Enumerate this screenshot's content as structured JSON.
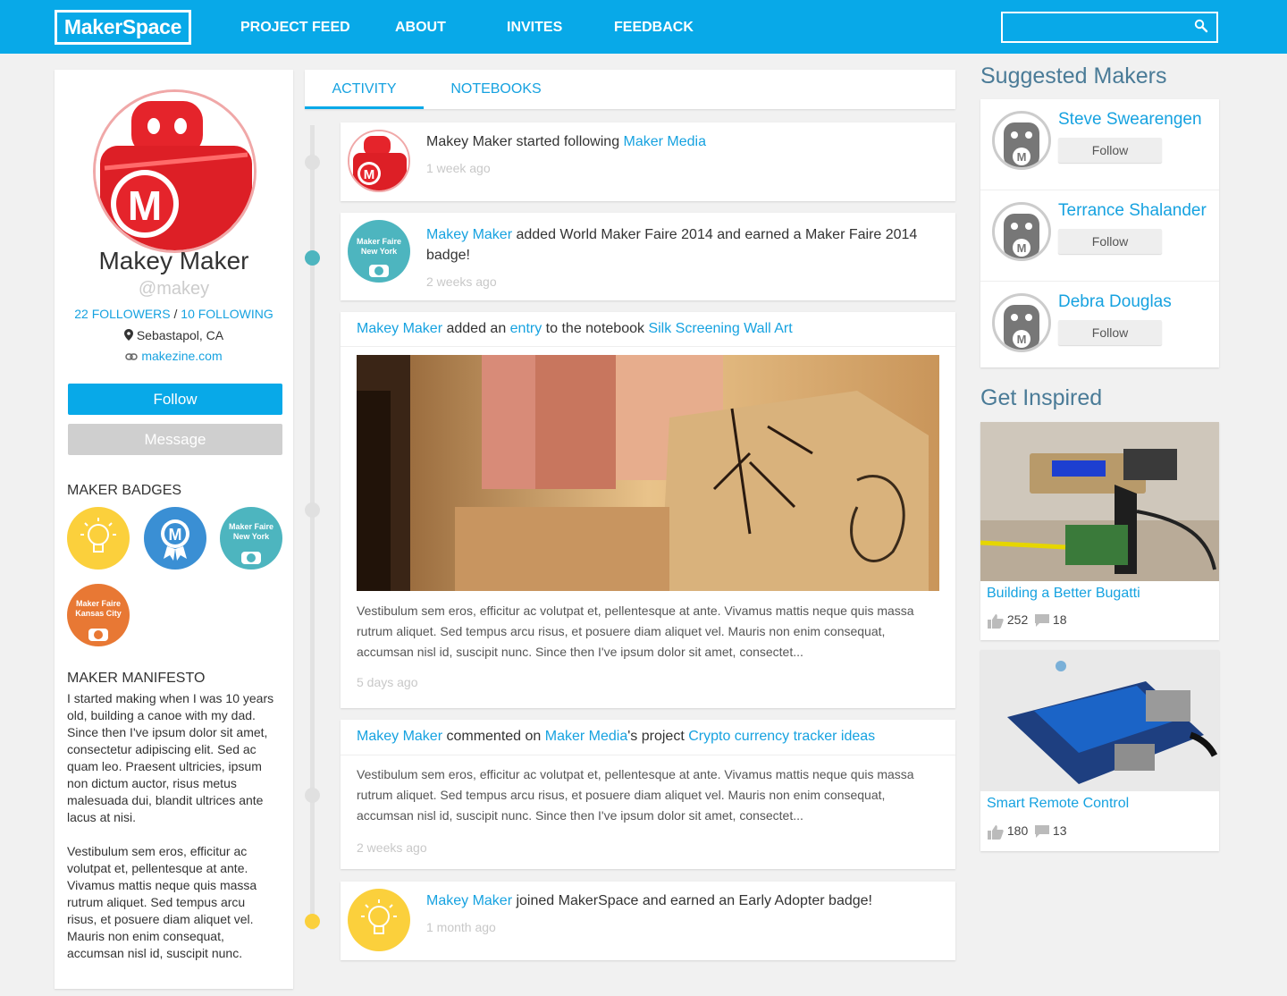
{
  "app": {
    "logo": "MakerSpace",
    "brand_color": "#08a9e8"
  },
  "nav": {
    "items": [
      "PROJECT FEED",
      "ABOUT",
      "INVITES",
      "FEEDBACK"
    ],
    "search_placeholder": ""
  },
  "profile": {
    "name": "Makey Maker",
    "handle": "@makey",
    "followers": "22 FOLLOWERS",
    "separator": "/",
    "following": "10 FOLLOWING",
    "location": "Sebastapol, CA",
    "website": "makezine.com",
    "follow_label": "Follow",
    "message_label": "Message",
    "badges_title": "MAKER BADGES",
    "badges": [
      {
        "icon": "lightbulb-icon",
        "color": "#fbd03c",
        "text": ""
      },
      {
        "icon": "maker-rosette-icon",
        "color": "#3a8fd4",
        "text": ""
      },
      {
        "icon": "maker-robot-icon",
        "color": "#4db5bf",
        "text": "Maker Faire New York"
      },
      {
        "icon": "maker-robot-icon",
        "color": "#e87834",
        "text": "Maker Faire Kansas City"
      }
    ],
    "manifesto_title": "MAKER MANIFESTO",
    "manifesto": [
      "I started making when I was 10 years old, building a canoe with my dad. Since then I've ipsum dolor sit amet, consectetur adipiscing elit. Sed ac quam leo. Praesent ultricies, ipsum non dictum auctor, risus metus malesuada dui, blandit ultrices ante lacus at nisi.",
      "Vestibulum sem eros, efficitur ac volutpat et, pellentesque at ante. Vivamus mattis neque quis massa rutrum aliquet. Sed tempus arcu risus, et posuere diam aliquet vel. Mauris non enim consequat, accumsan nisl id, suscipit nunc."
    ]
  },
  "tabs": {
    "activity": "ACTIVITY",
    "notebooks": "NOTEBOOKS"
  },
  "feed": {
    "item1": {
      "text": "Makey Maker started following ",
      "link": "Maker Media",
      "time": "1 week ago"
    },
    "item2": {
      "actor": "Makey Maker",
      "text": " added World Maker Faire 2014 and earned a Maker Faire 2014",
      "text2": "badge!",
      "badge_text": "Maker Faire New York",
      "time": "2 weeks ago"
    },
    "item3": {
      "actor": "Makey Maker",
      "t1": " added an ",
      "entry": "entry",
      "t2": " to the notebook ",
      "notebook": "Silk Screening Wall Art",
      "body": "Vestibulum sem eros, efficitur ac volutpat et, pellentesque at ante. Vivamus mattis neque quis massa rutrum aliquet. Sed tempus arcu risus, et posuere diam aliquet vel. Mauris non enim consequat, accumsan nisl id, suscipit nunc. Since then I've ipsum dolor sit amet, consectet...",
      "time": "5 days ago"
    },
    "item4": {
      "actor": "Makey Maker",
      "t1": " commented on ",
      "owner": "Maker Media",
      "t2": "'s project ",
      "project": "Crypto currency tracker ideas",
      "body": "Vestibulum sem eros, efficitur ac volutpat et, pellentesque at ante. Vivamus mattis neque quis massa rutrum aliquet. Sed tempus arcu risus, et posuere diam aliquet vel. Mauris non enim consequat, accumsan nisl id, suscipit nunc. Since then I've ipsum dolor sit amet, consectet...",
      "time": "2 weeks ago"
    },
    "item5": {
      "actor": "Makey Maker",
      "text": " joined MakerSpace and earned an Early Adopter badge!",
      "time": "1 month ago"
    }
  },
  "suggested": {
    "title": "Suggested Makers",
    "makers": [
      {
        "name": "Steve Swearengen",
        "follow": "Follow"
      },
      {
        "name": "Terrance Shalander",
        "follow": "Follow"
      },
      {
        "name": "Debra Douglas",
        "follow": "Follow"
      }
    ]
  },
  "inspired": {
    "title": "Get Inspired",
    "projects": [
      {
        "title": "Building a Better Bugatti",
        "likes": "252",
        "comments": "18"
      },
      {
        "title": "Smart Remote Control",
        "likes": "180",
        "comments": "13"
      }
    ]
  }
}
